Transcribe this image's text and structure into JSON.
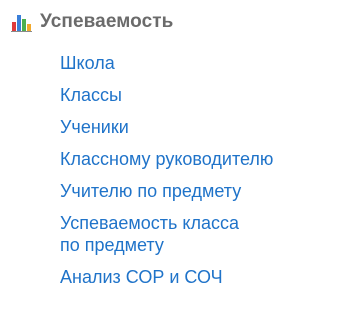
{
  "header": {
    "title": "Успеваемость",
    "icon": "bar-chart-icon",
    "icon_colors": [
      "#e03a3a",
      "#3a7fd9",
      "#4caf50",
      "#f2a92c"
    ]
  },
  "items": [
    {
      "label": "Школа"
    },
    {
      "label": "Классы"
    },
    {
      "label": "Ученики"
    },
    {
      "label": "Классному руководителю"
    },
    {
      "label": "Учителю по предмету"
    },
    {
      "label_line1": "Успеваемость класса",
      "label_line2": "по предмету"
    },
    {
      "label": "Анализ СОР и СОЧ"
    }
  ],
  "colors": {
    "link": "#1f73c9",
    "header_text": "#6b6b6b"
  }
}
